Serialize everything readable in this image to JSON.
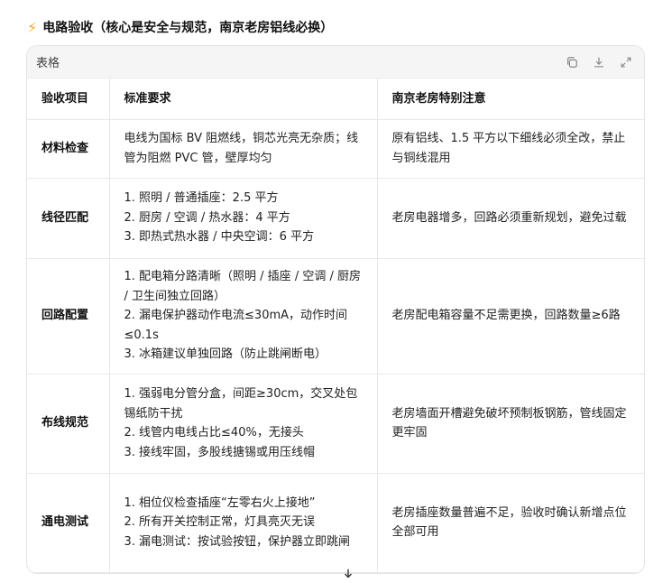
{
  "heading": {
    "icon": "lightning-bolt-icon",
    "text": "电路验收（核心是安全与规范，南京老房铝线必换）"
  },
  "card": {
    "title": "表格",
    "tools": [
      "copy-icon",
      "download-icon",
      "expand-icon"
    ]
  },
  "table": {
    "headers": [
      "验收项目",
      "标准要求",
      "南京老房特别注意"
    ],
    "rows": [
      {
        "item": "材料检查",
        "requirements": [
          "电线为国标 BV 阻燃线，铜芯光亮无杂质；线管为阻燃 PVC 管，壁厚均匀"
        ],
        "note": "原有铝线、1.5 平方以下细线必须全改，禁止与铜线混用"
      },
      {
        "item": "线径匹配",
        "requirements": [
          "1. 照明 / 普通插座：2.5 平方",
          "2. 厨房 / 空调 / 热水器：4 平方",
          "3. 即热式热水器 / 中央空调：6 平方"
        ],
        "note": "老房电器增多，回路必须重新规划，避免过载"
      },
      {
        "item": "回路配置",
        "requirements": [
          "1. 配电箱分路清晰（照明 / 插座 / 空调 / 厨房 / 卫生间独立回路）",
          "2. 漏电保护器动作电流≤30mA，动作时间≤0.1s",
          "3. 冰箱建议单独回路（防止跳闸断电）"
        ],
        "note": "老房配电箱容量不足需更换，回路数量≥6路"
      },
      {
        "item": "布线规范",
        "requirements": [
          "1. 强弱电分管分盒，间距≥30cm，交叉处包锡纸防干扰",
          "2. 线管内电线占比≤40%，无接头",
          "3. 接线牢固，多股线搪锡或用压线帽"
        ],
        "note": "老房墙面开槽避免破坏预制板钢筋，管线固定更牢固"
      },
      {
        "item": "通电测试",
        "requirements": [
          "1. 相位仪检查插座“左零右火上接地”",
          "2. 所有开关控制正常，灯具亮灭无误",
          "3. 漏电测试：按试验按钮，保护器立即跳闸"
        ],
        "note": "老房插座数量普遍不足，验收时确认新增点位全部可用"
      }
    ]
  },
  "colors": {
    "accent_bolt": "#f5a623",
    "border": "#e8e8e8",
    "header_bg": "#f5f5f5"
  }
}
